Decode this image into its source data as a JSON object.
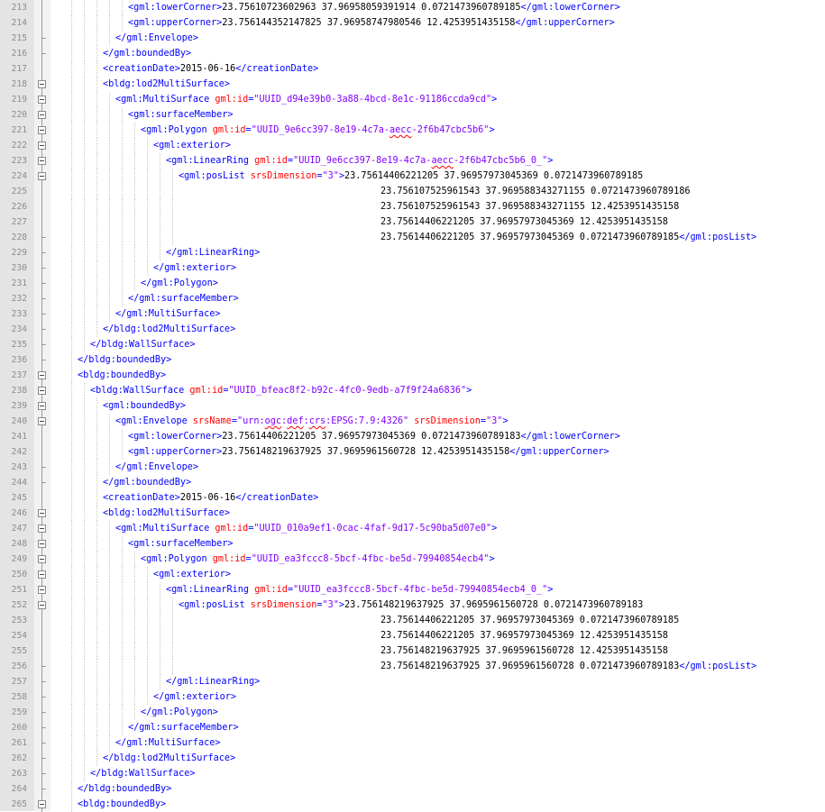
{
  "editor": {
    "first_line_number": 213,
    "lines": [
      {
        "indent": 5,
        "fold": "line",
        "segments": [
          [
            "t",
            "<gml:lowerCorner>"
          ],
          [
            "x",
            "23.75610723602963 37.96958059391914 0.0721473960789185"
          ],
          [
            "t",
            "</gml:lowerCorner>"
          ]
        ]
      },
      {
        "indent": 5,
        "fold": "line",
        "segments": [
          [
            "t",
            "<gml:upperCorner>"
          ],
          [
            "x",
            "23.756144352147825 37.96958747980546 12.4253951435158"
          ],
          [
            "t",
            "</gml:upperCorner>"
          ]
        ]
      },
      {
        "indent": 4,
        "fold": "end",
        "segments": [
          [
            "t",
            "</gml:Envelope>"
          ]
        ]
      },
      {
        "indent": 3,
        "fold": "end",
        "segments": [
          [
            "t",
            "</gml:boundedBy>"
          ]
        ]
      },
      {
        "indent": 3,
        "fold": "line",
        "segments": [
          [
            "t",
            "<creationDate>"
          ],
          [
            "x",
            "2015-06-16"
          ],
          [
            "t",
            "</creationDate>"
          ]
        ]
      },
      {
        "indent": 3,
        "fold": "box",
        "segments": [
          [
            "t",
            "<bldg:lod2MultiSurface>"
          ]
        ]
      },
      {
        "indent": 4,
        "fold": "box",
        "segments": [
          [
            "t",
            "<gml:MultiSurface "
          ],
          [
            "a",
            "gml:id"
          ],
          [
            "t",
            "="
          ],
          [
            "v",
            "\"UUID_d94e39b0-3a88-4bcd-8e1c-91186ccda9cd\""
          ],
          [
            "t",
            ">"
          ]
        ]
      },
      {
        "indent": 5,
        "fold": "box",
        "segments": [
          [
            "t",
            "<gml:surfaceMember>"
          ]
        ]
      },
      {
        "indent": 6,
        "fold": "box",
        "segments": [
          [
            "t",
            "<gml:Polygon "
          ],
          [
            "a",
            "gml:id"
          ],
          [
            "t",
            "="
          ],
          [
            "v",
            "\"UUID_9e6cc397-8e19-4c7a-"
          ],
          [
            "q",
            "aecc"
          ],
          [
            "v",
            "-2f6b47cbc5b6\""
          ],
          [
            "t",
            ">"
          ]
        ]
      },
      {
        "indent": 7,
        "fold": "box",
        "segments": [
          [
            "t",
            "<gml:exterior>"
          ]
        ]
      },
      {
        "indent": 8,
        "fold": "box",
        "segments": [
          [
            "t",
            "<gml:LinearRing "
          ],
          [
            "a",
            "gml:id"
          ],
          [
            "t",
            "="
          ],
          [
            "v",
            "\"UUID_9e6cc397-8e19-4c7a-"
          ],
          [
            "q",
            "aecc"
          ],
          [
            "v",
            "-2f6b47cbc5b6_0_\""
          ],
          [
            "t",
            ">"
          ]
        ]
      },
      {
        "indent": 9,
        "fold": "box",
        "segments": [
          [
            "t",
            "<gml:posList "
          ],
          [
            "a",
            "srsDimension"
          ],
          [
            "t",
            "="
          ],
          [
            "v",
            "\"3\""
          ],
          [
            "t",
            ">"
          ],
          [
            "x",
            "23.75614406221205 37.96957973045369 0.0721473960789185"
          ]
        ]
      },
      {
        "indent": 9,
        "cont": true,
        "fold": "line",
        "segments": [
          [
            "x",
            "23.756107525961543 37.969588343271155 0.0721473960789186"
          ]
        ]
      },
      {
        "indent": 9,
        "cont": true,
        "fold": "line",
        "segments": [
          [
            "x",
            "23.756107525961543 37.969588343271155 12.4253951435158"
          ]
        ]
      },
      {
        "indent": 9,
        "cont": true,
        "fold": "line",
        "segments": [
          [
            "x",
            "23.75614406221205 37.96957973045369 12.4253951435158"
          ]
        ]
      },
      {
        "indent": 9,
        "cont": true,
        "fold": "end",
        "segments": [
          [
            "x",
            "23.75614406221205 37.96957973045369 0.0721473960789185"
          ],
          [
            "t",
            "</gml:posList>"
          ]
        ]
      },
      {
        "indent": 8,
        "fold": "end",
        "segments": [
          [
            "t",
            "</gml:LinearRing>"
          ]
        ]
      },
      {
        "indent": 7,
        "fold": "end",
        "segments": [
          [
            "t",
            "</gml:exterior>"
          ]
        ]
      },
      {
        "indent": 6,
        "fold": "end",
        "segments": [
          [
            "t",
            "</gml:Polygon>"
          ]
        ]
      },
      {
        "indent": 5,
        "fold": "end",
        "segments": [
          [
            "t",
            "</gml:surfaceMember>"
          ]
        ]
      },
      {
        "indent": 4,
        "fold": "end",
        "segments": [
          [
            "t",
            "</gml:MultiSurface>"
          ]
        ]
      },
      {
        "indent": 3,
        "fold": "end",
        "segments": [
          [
            "t",
            "</bldg:lod2MultiSurface>"
          ]
        ]
      },
      {
        "indent": 2,
        "fold": "end",
        "segments": [
          [
            "t",
            "</bldg:WallSurface>"
          ]
        ]
      },
      {
        "indent": 1,
        "fold": "end",
        "segments": [
          [
            "t",
            "</bldg:boundedBy>"
          ]
        ]
      },
      {
        "indent": 1,
        "fold": "box",
        "segments": [
          [
            "t",
            "<bldg:boundedBy>"
          ]
        ]
      },
      {
        "indent": 2,
        "fold": "box",
        "segments": [
          [
            "t",
            "<bldg:WallSurface "
          ],
          [
            "a",
            "gml:id"
          ],
          [
            "t",
            "="
          ],
          [
            "v",
            "\"UUID_bfeac8f2-b92c-4fc0-9edb-a7f9f24a6836\""
          ],
          [
            "t",
            ">"
          ]
        ]
      },
      {
        "indent": 3,
        "fold": "box",
        "segments": [
          [
            "t",
            "<gml:boundedBy>"
          ]
        ]
      },
      {
        "indent": 4,
        "fold": "box",
        "segments": [
          [
            "t",
            "<gml:Envelope "
          ],
          [
            "a",
            "srsName"
          ],
          [
            "t",
            "="
          ],
          [
            "v",
            "\"urn:"
          ],
          [
            "q",
            "ogc"
          ],
          [
            "v",
            ":"
          ],
          [
            "q",
            "def"
          ],
          [
            "v",
            ":"
          ],
          [
            "q",
            "crs"
          ],
          [
            "v",
            ":EPSG:7.9:4326\""
          ],
          [
            "t",
            " "
          ],
          [
            "a",
            "srsDimension"
          ],
          [
            "t",
            "="
          ],
          [
            "v",
            "\"3\""
          ],
          [
            "t",
            ">"
          ]
        ]
      },
      {
        "indent": 5,
        "fold": "line",
        "segments": [
          [
            "t",
            "<gml:lowerCorner>"
          ],
          [
            "x",
            "23.75614406221205 37.96957973045369 0.0721473960789183"
          ],
          [
            "t",
            "</gml:lowerCorner>"
          ]
        ]
      },
      {
        "indent": 5,
        "fold": "line",
        "segments": [
          [
            "t",
            "<gml:upperCorner>"
          ],
          [
            "x",
            "23.756148219637925 37.9695961560728 12.4253951435158"
          ],
          [
            "t",
            "</gml:upperCorner>"
          ]
        ]
      },
      {
        "indent": 4,
        "fold": "end",
        "segments": [
          [
            "t",
            "</gml:Envelope>"
          ]
        ]
      },
      {
        "indent": 3,
        "fold": "end",
        "segments": [
          [
            "t",
            "</gml:boundedBy>"
          ]
        ]
      },
      {
        "indent": 3,
        "fold": "line",
        "segments": [
          [
            "t",
            "<creationDate>"
          ],
          [
            "x",
            "2015-06-16"
          ],
          [
            "t",
            "</creationDate>"
          ]
        ]
      },
      {
        "indent": 3,
        "fold": "box",
        "segments": [
          [
            "t",
            "<bldg:lod2MultiSurface>"
          ]
        ]
      },
      {
        "indent": 4,
        "fold": "box",
        "segments": [
          [
            "t",
            "<gml:MultiSurface "
          ],
          [
            "a",
            "gml:id"
          ],
          [
            "t",
            "="
          ],
          [
            "v",
            "\"UUID_010a9ef1-0cac-4faf-9d17-5c90ba5d07e0\""
          ],
          [
            "t",
            ">"
          ]
        ]
      },
      {
        "indent": 5,
        "fold": "box",
        "segments": [
          [
            "t",
            "<gml:surfaceMember>"
          ]
        ]
      },
      {
        "indent": 6,
        "fold": "box",
        "segments": [
          [
            "t",
            "<gml:Polygon "
          ],
          [
            "a",
            "gml:id"
          ],
          [
            "t",
            "="
          ],
          [
            "v",
            "\"UUID_ea3fccc8-5bcf-4fbc-be5d-79940854ecb4\""
          ],
          [
            "t",
            ">"
          ]
        ]
      },
      {
        "indent": 7,
        "fold": "box",
        "segments": [
          [
            "t",
            "<gml:exterior>"
          ]
        ]
      },
      {
        "indent": 8,
        "fold": "box",
        "segments": [
          [
            "t",
            "<gml:LinearRing "
          ],
          [
            "a",
            "gml:id"
          ],
          [
            "t",
            "="
          ],
          [
            "v",
            "\"UUID_ea3fccc8-5bcf-4fbc-be5d-79940854ecb4_0_\""
          ],
          [
            "t",
            ">"
          ]
        ]
      },
      {
        "indent": 9,
        "fold": "box",
        "segments": [
          [
            "t",
            "<gml:posList "
          ],
          [
            "a",
            "srsDimension"
          ],
          [
            "t",
            "="
          ],
          [
            "v",
            "\"3\""
          ],
          [
            "t",
            ">"
          ],
          [
            "x",
            "23.756148219637925 37.9695961560728 0.0721473960789183"
          ]
        ]
      },
      {
        "indent": 9,
        "cont": true,
        "fold": "line",
        "segments": [
          [
            "x",
            "23.75614406221205 37.96957973045369 0.0721473960789185"
          ]
        ]
      },
      {
        "indent": 9,
        "cont": true,
        "fold": "line",
        "segments": [
          [
            "x",
            "23.75614406221205 37.96957973045369 12.4253951435158"
          ]
        ]
      },
      {
        "indent": 9,
        "cont": true,
        "fold": "line",
        "segments": [
          [
            "x",
            "23.756148219637925 37.9695961560728 12.4253951435158"
          ]
        ]
      },
      {
        "indent": 9,
        "cont": true,
        "fold": "end",
        "segments": [
          [
            "x",
            "23.756148219637925 37.9695961560728 0.0721473960789183"
          ],
          [
            "t",
            "</gml:posList>"
          ]
        ]
      },
      {
        "indent": 8,
        "fold": "end",
        "segments": [
          [
            "t",
            "</gml:LinearRing>"
          ]
        ]
      },
      {
        "indent": 7,
        "fold": "end",
        "segments": [
          [
            "t",
            "</gml:exterior>"
          ]
        ]
      },
      {
        "indent": 6,
        "fold": "end",
        "segments": [
          [
            "t",
            "</gml:Polygon>"
          ]
        ]
      },
      {
        "indent": 5,
        "fold": "end",
        "segments": [
          [
            "t",
            "</gml:surfaceMember>"
          ]
        ]
      },
      {
        "indent": 4,
        "fold": "end",
        "segments": [
          [
            "t",
            "</gml:MultiSurface>"
          ]
        ]
      },
      {
        "indent": 3,
        "fold": "end",
        "segments": [
          [
            "t",
            "</bldg:lod2MultiSurface>"
          ]
        ]
      },
      {
        "indent": 2,
        "fold": "end",
        "segments": [
          [
            "t",
            "</bldg:WallSurface>"
          ]
        ]
      },
      {
        "indent": 1,
        "fold": "end",
        "segments": [
          [
            "t",
            "</bldg:boundedBy>"
          ]
        ]
      },
      {
        "indent": 1,
        "fold": "box",
        "segments": [
          [
            "t",
            "<bldg:boundedBy>"
          ]
        ]
      }
    ]
  },
  "colors": {
    "tag": "#0000ff",
    "attribute": "#ff0000",
    "attribute_value": "#8000ff",
    "text": "#000000",
    "gutter": "#e4e4e4",
    "line_number": "#8c8c8c"
  }
}
